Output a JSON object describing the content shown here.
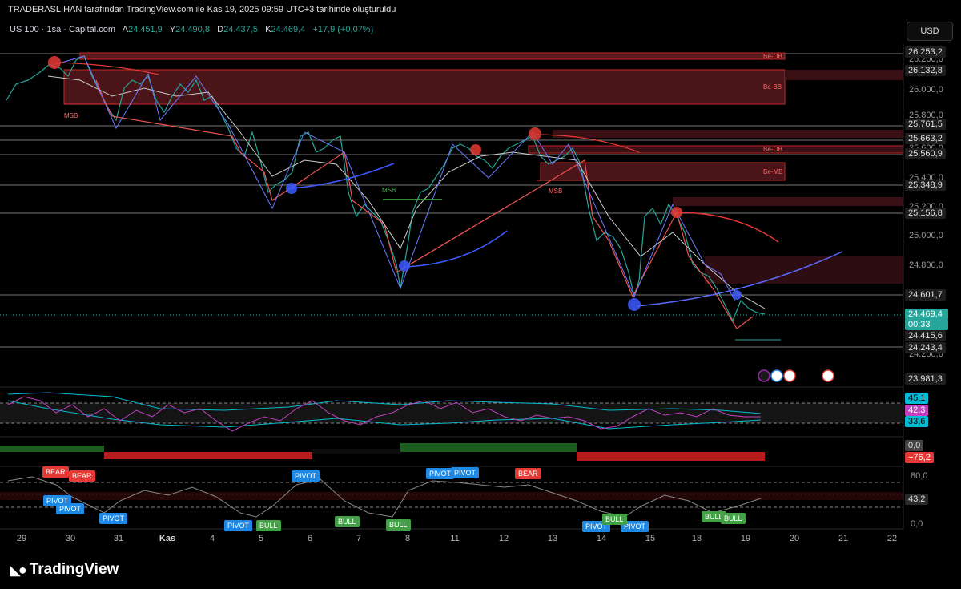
{
  "header": {
    "credit": "TRADERASLIHAN tarafından TradingView.com ile Kas 19, 2025 09:59 UTC+3 tarihinde oluşturuldu"
  },
  "symbol": {
    "name": "US 100 · 1sa · Capital.com",
    "open_label": "A",
    "open": "24.451,9",
    "high_label": "Y",
    "high": "24.490,8",
    "low_label": "D",
    "low": "24.437,5",
    "close_label": "K",
    "close": "24.469,4",
    "change": "+17,9 (+0,07%)"
  },
  "currency_button": "USD",
  "price_axis": {
    "ticks": [
      "26.200,0",
      "26.000,0",
      "25.800,0",
      "25.600,0",
      "25.400,0",
      "25.200,0",
      "25.000,0",
      "24.800,0",
      "24.200,0"
    ],
    "labels": [
      {
        "text": "26.253,2",
        "kind": "gray"
      },
      {
        "text": "26.132,8",
        "kind": "gray"
      },
      {
        "text": "25.761,5",
        "kind": "gray"
      },
      {
        "text": "25.663,2",
        "kind": "gray"
      },
      {
        "text": "25.560,9",
        "kind": "gray"
      },
      {
        "text": "25.348,9",
        "kind": "gray"
      },
      {
        "text": "25.156,8",
        "kind": "gray"
      },
      {
        "text": "24.601,7",
        "kind": "gray"
      },
      {
        "text": "24.469,4",
        "kind": "green"
      },
      {
        "text": "00:33",
        "kind": "green"
      },
      {
        "text": "24.415,6",
        "kind": "gray"
      },
      {
        "text": "24.243,4",
        "kind": "gray"
      },
      {
        "text": "23.981,3",
        "kind": "gray"
      }
    ]
  },
  "indicator1": {
    "labels": [
      {
        "text": "45,1",
        "color": "#00bcd4"
      },
      {
        "text": "42,3",
        "color": "#c040c0"
      },
      {
        "text": "33,6",
        "color": "#00bcd4"
      }
    ]
  },
  "indicator2": {
    "labels": [
      {
        "text": "0,0",
        "color": "#444444"
      },
      {
        "text": "−76,2",
        "color": "#e53935"
      }
    ]
  },
  "indicator3": {
    "ticks": [
      "80,0",
      "0,0"
    ],
    "label": "43,2"
  },
  "time_axis": [
    "29",
    "30",
    "31",
    "Kas",
    "4",
    "5",
    "6",
    "7",
    "8",
    "11",
    "12",
    "13",
    "14",
    "15",
    "18",
    "19",
    "20",
    "21",
    "22"
  ],
  "zones": {
    "be_ob_1": "Be-OB",
    "be_bb": "Be-BB",
    "be_ob_2": "Be-OB",
    "be_mb": "Be-MB"
  },
  "msb": [
    "MSB",
    "MSB",
    "MSB"
  ],
  "tags": [
    {
      "text": "BEAR",
      "type": "bear"
    },
    {
      "text": "BEAR",
      "type": "bear"
    },
    {
      "text": "BEAR",
      "type": "bear"
    },
    {
      "text": "PIVOT",
      "type": "pivot"
    },
    {
      "text": "PIVOT",
      "type": "pivot"
    },
    {
      "text": "PIVOT",
      "type": "pivot"
    },
    {
      "text": "PIVOT",
      "type": "pivot"
    },
    {
      "text": "PIVOT",
      "type": "pivot"
    },
    {
      "text": "PIVOT",
      "type": "pivot"
    },
    {
      "text": "PIVOT",
      "type": "pivot"
    },
    {
      "text": "PIVOT",
      "type": "pivot"
    },
    {
      "text": "PIVOT",
      "type": "pivot"
    },
    {
      "text": "BULL",
      "type": "bull"
    },
    {
      "text": "BULL",
      "type": "bull"
    },
    {
      "text": "BULL",
      "type": "bull"
    },
    {
      "text": "BULL",
      "type": "bull"
    },
    {
      "text": "BULL",
      "type": "bull"
    },
    {
      "text": "BULL",
      "type": "bull"
    }
  ],
  "footer": {
    "brand": "TradingView"
  },
  "colors": {
    "background": "#000000",
    "bull": "#26a69a",
    "bear": "#ef5350",
    "zone": "#e53935",
    "rsi": "#c040c0",
    "band": "#00bcd4"
  }
}
